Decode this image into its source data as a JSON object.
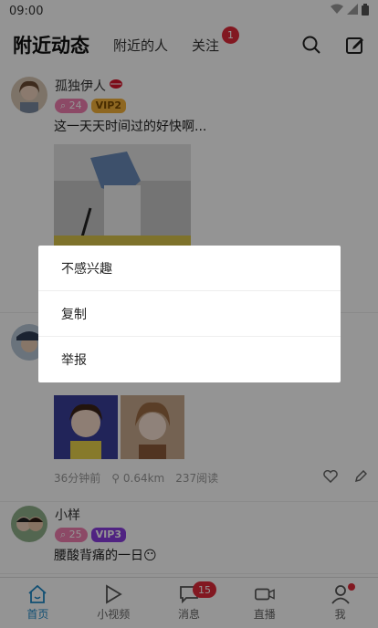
{
  "status": {
    "time": "09:00"
  },
  "nav": {
    "title": "附近动态",
    "tabs": [
      {
        "label": "附近的人"
      },
      {
        "label": "关注",
        "badge": "1"
      }
    ]
  },
  "posts": [
    {
      "username": "孤独伊人",
      "level": "24",
      "vip": "VIP2",
      "text": "这一天天时间过的好快啊..."
    },
    {
      "time": "36分钟前",
      "distance": "0.64km",
      "reads": "237阅读"
    },
    {
      "username": "小样",
      "level": "25",
      "vip": "VIP3",
      "text": "腰酸背痛的一日😶"
    }
  ],
  "popup": {
    "items": [
      "不感兴趣",
      "复制",
      "举报"
    ]
  },
  "tabbar": {
    "items": [
      {
        "label": "首页"
      },
      {
        "label": "小视频"
      },
      {
        "label": "消息",
        "badge": "15"
      },
      {
        "label": "直播"
      },
      {
        "label": "我"
      }
    ]
  },
  "colors": {
    "accent": "#1e88c7",
    "badge": "#e02a3a",
    "vip2": "#f5b23a",
    "vip3": "#8a3de0",
    "level": "#f27fb0"
  }
}
